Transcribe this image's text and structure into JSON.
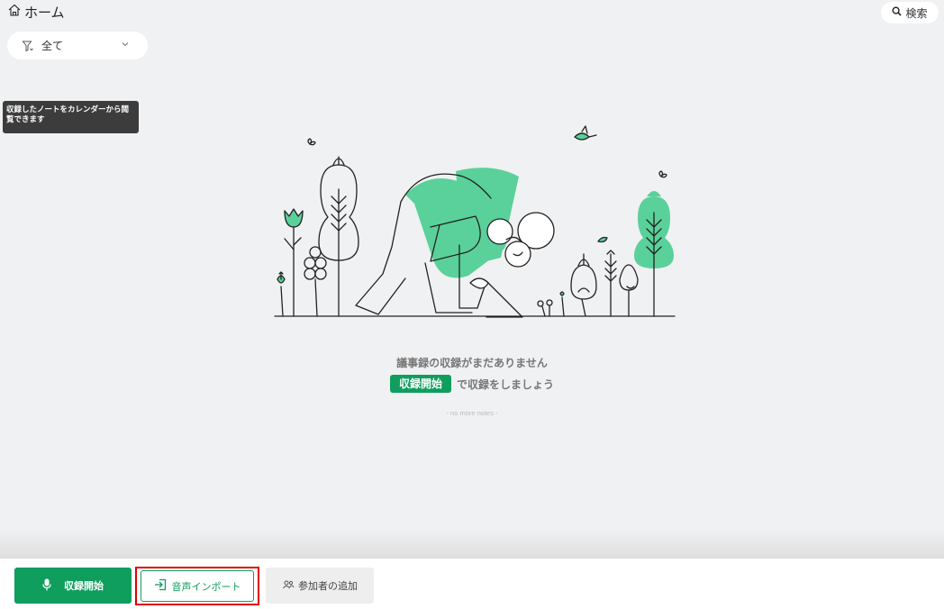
{
  "header": {
    "title": "ホーム",
    "search_label": "検索"
  },
  "filter": {
    "selected": "全て"
  },
  "tooltip": {
    "text": "収録したノートをカレンダーから閲覧できます"
  },
  "empty_state": {
    "message": "議事録の収録がまだありません",
    "cta_pill": "収録開始",
    "cta_suffix": "で収録をしましょう",
    "no_more": "- no more notes -"
  },
  "bottom_bar": {
    "record_label": "収録開始",
    "import_label": "音声インポート",
    "participants_label": "参加者の追加"
  },
  "colors": {
    "accent": "#0f9e5e",
    "illustration_green": "#5ad19a",
    "highlight_border": "#e00000"
  }
}
